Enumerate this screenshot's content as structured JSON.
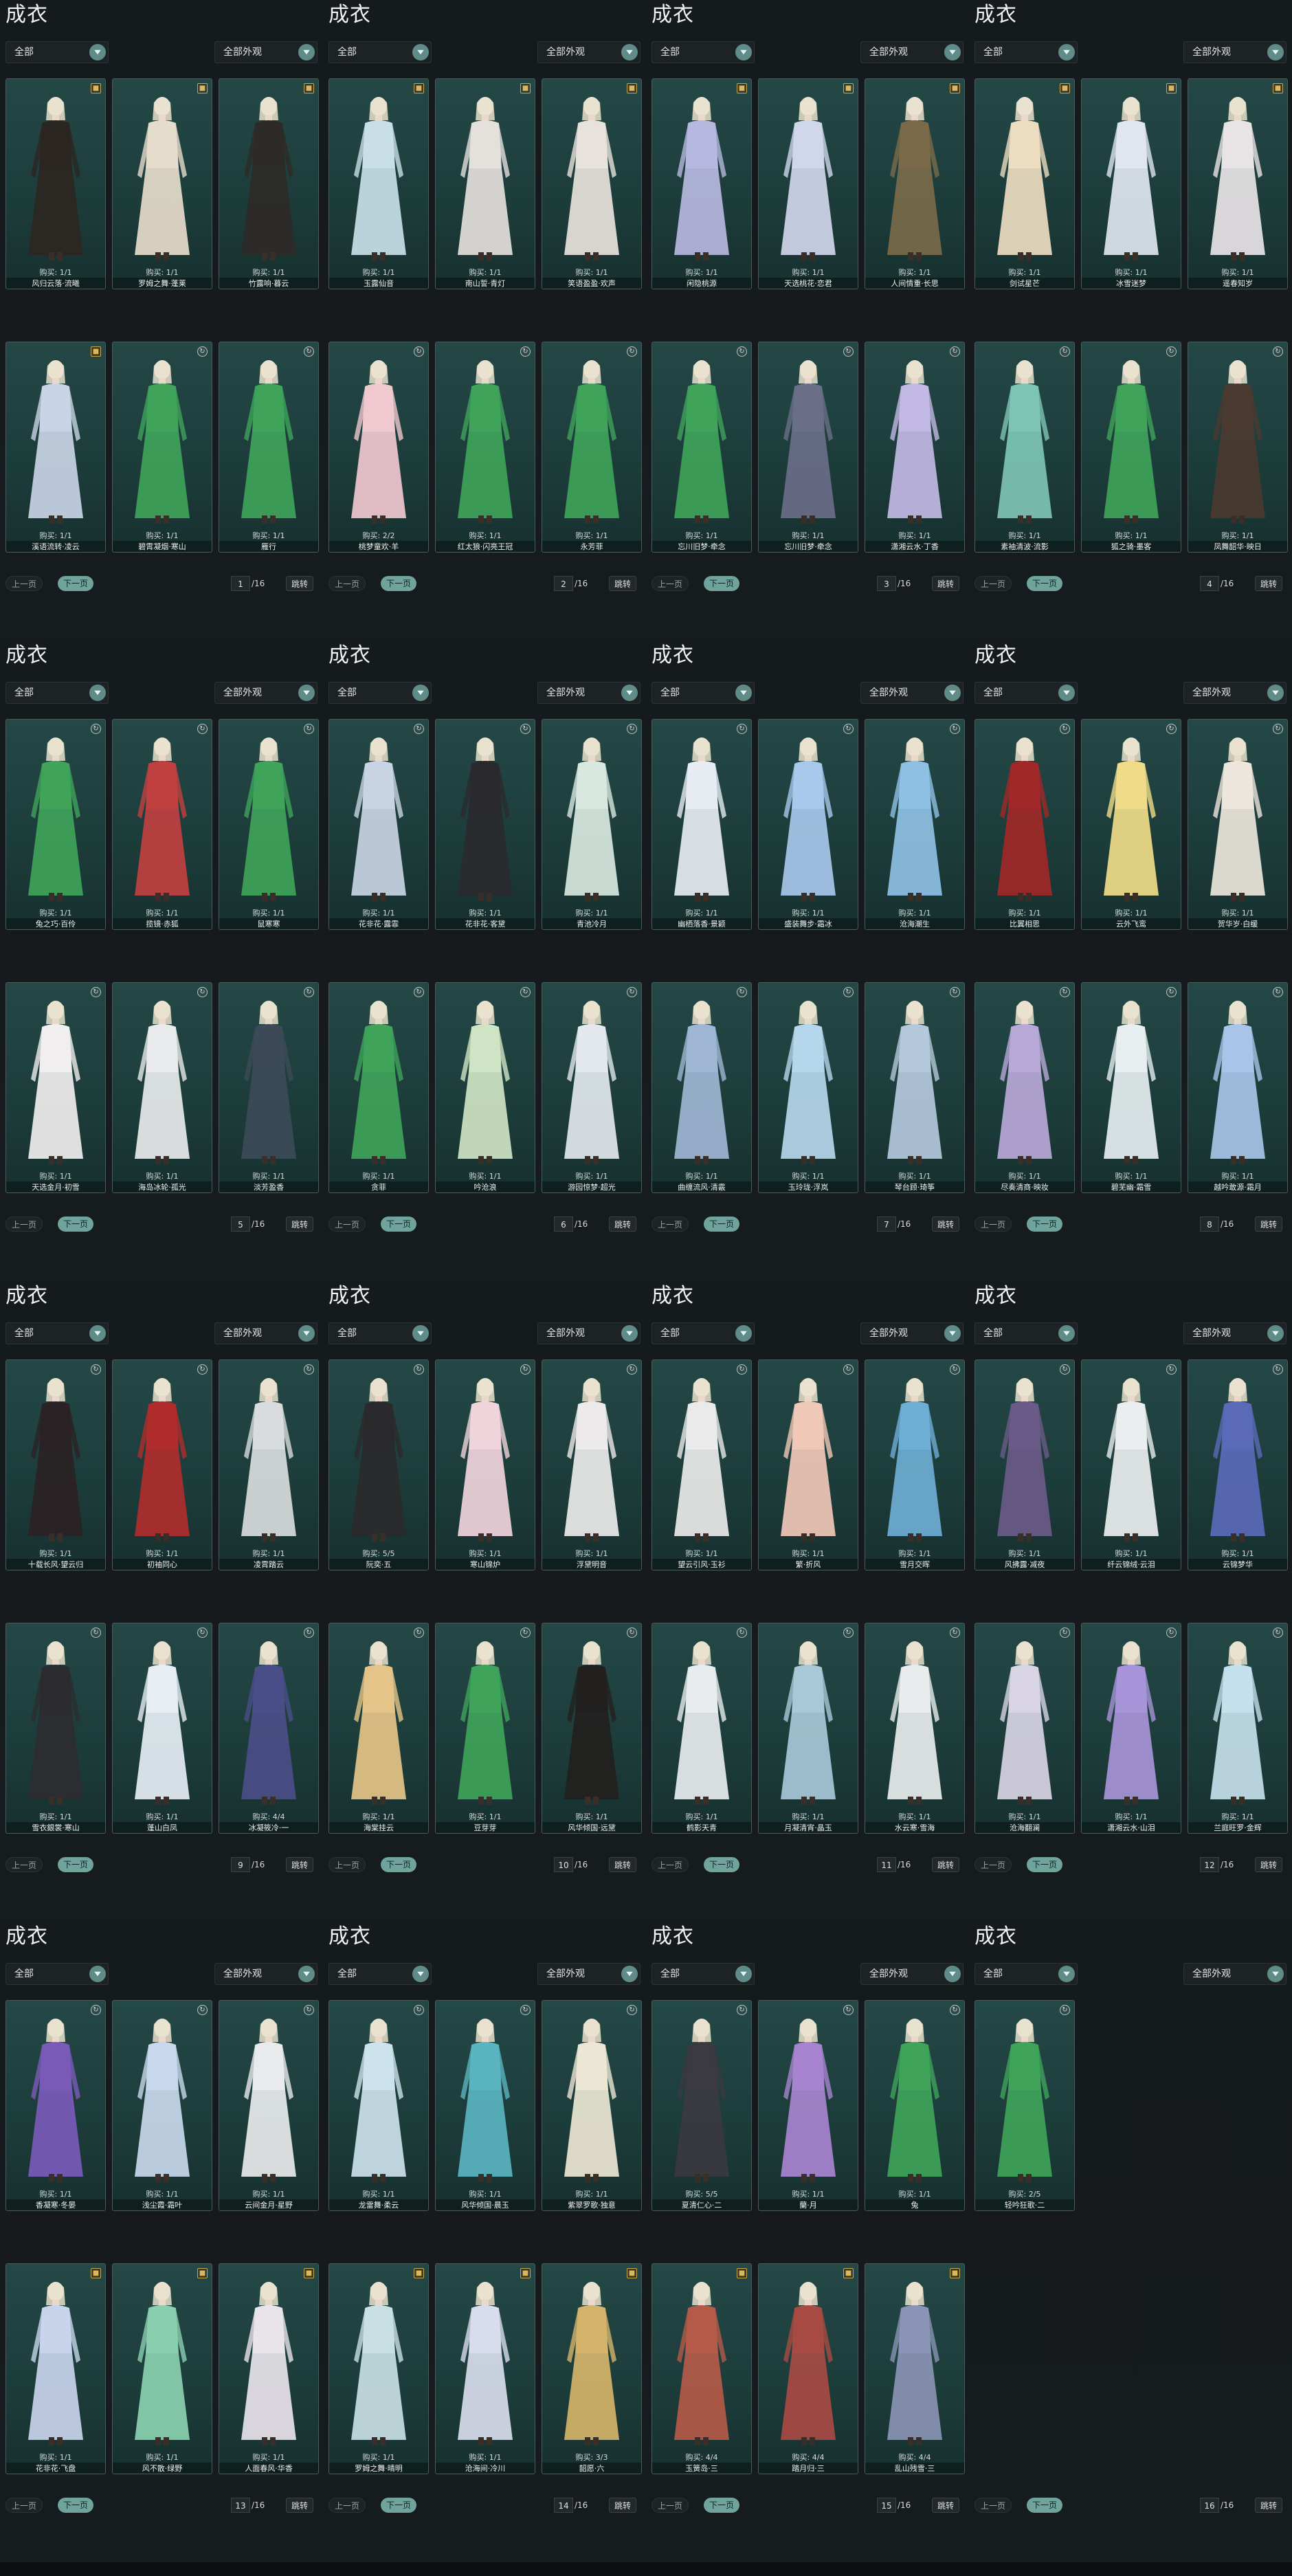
{
  "panel_title": "成衣",
  "filter_all": "全部",
  "filter_look": "全部外观",
  "buttons": {
    "prev": "上一页",
    "next": "下一页",
    "go": "跳转"
  },
  "total_pages": "/16",
  "colors": {
    "accent": "#6fa39c",
    "card_bg": "#244846",
    "gold_tag": "#c9a64b"
  },
  "panels": [
    {
      "page": "1",
      "items": [
        {
          "name": "风归云落·流曦",
          "buy": "购买: 1/1",
          "tag": "gold",
          "c": "#2c2622"
        },
        {
          "name": "罗姆之舞·蓬莱",
          "buy": "购买: 1/1",
          "tag": "gold",
          "c": "#e6dccb"
        },
        {
          "name": "竹露响·暮云",
          "buy": "购买: 1/1",
          "tag": "gold",
          "c": "#2e2a28"
        },
        {
          "name": "溪语流转·凌云",
          "buy": "购买: 1/1",
          "tag": "gold",
          "c": "#c8d4e6"
        },
        {
          "name": "碧霄凝烟·寒山",
          "buy": "购买: 1/1",
          "tag": "round",
          "c": "#3fa35a"
        },
        {
          "name": "雁行",
          "buy": "购买: 1/1",
          "tag": "round",
          "c": "#3fa35a"
        }
      ]
    },
    {
      "page": "2",
      "items": [
        {
          "name": "玉露仙音",
          "buy": "购买: 1/1",
          "tag": "gold",
          "c": "#c8dfe8"
        },
        {
          "name": "南山誓·青灯",
          "buy": "购买: 1/1",
          "tag": "gold",
          "c": "#e4e0dc"
        },
        {
          "name": "笑语盈盈·欢声",
          "buy": "购买: 1/1",
          "tag": "gold",
          "c": "#e8e2dc"
        },
        {
          "name": "桃梦童欢·羊",
          "buy": "购买: 2/2",
          "tag": "round",
          "c": "#f0c8d0"
        },
        {
          "name": "红太狼·闪亮王冠",
          "buy": "购买: 1/1",
          "tag": "round",
          "c": "#3fa35a"
        },
        {
          "name": "永芳菲",
          "buy": "购买: 1/1",
          "tag": "round",
          "c": "#3fa35a"
        }
      ]
    },
    {
      "page": "3",
      "items": [
        {
          "name": "闲隐桃源",
          "buy": "购买: 1/1",
          "tag": "gold",
          "c": "#b7b8e0"
        },
        {
          "name": "天选桃花·恋君",
          "buy": "购买: 1/1",
          "tag": "gold",
          "c": "#d0d6ec"
        },
        {
          "name": "人间情重·长思",
          "buy": "购买: 1/1",
          "tag": "gold",
          "c": "#7a6a4a"
        },
        {
          "name": "忘川旧梦·牵念",
          "buy": "购买: 1/1",
          "tag": "round",
          "c": "#3fa35a"
        },
        {
          "name": "忘川旧梦·牵念",
          "buy": "购买: 1/1",
          "tag": "round",
          "c": "#6a6e88"
        },
        {
          "name": "潇湘云水·丁香",
          "buy": "购买: 1/1",
          "tag": "round",
          "c": "#c2b8e4"
        }
      ]
    },
    {
      "page": "4",
      "items": [
        {
          "name": "剑试星芒",
          "buy": "购买: 1/1",
          "tag": "gold",
          "c": "#ecdcc0"
        },
        {
          "name": "冰雪迷梦",
          "buy": "购买: 1/1",
          "tag": "gold",
          "c": "#dfe6ee"
        },
        {
          "name": "遥春知岁",
          "buy": "购买: 1/1",
          "tag": "gold",
          "c": "#e8e4e6"
        },
        {
          "name": "素袖清波·流影",
          "buy": "购买: 1/1",
          "tag": "round",
          "c": "#7ec4b4"
        },
        {
          "name": "狐之骑·墨客",
          "buy": "购买: 1/1",
          "tag": "round",
          "c": "#3fa35a"
        },
        {
          "name": "凤舞韶华·映日",
          "buy": "购买: 1/1",
          "tag": "round",
          "c": "#4a3a30"
        }
      ]
    },
    {
      "page": "5",
      "items": [
        {
          "name": "兔之巧·百伶",
          "buy": "购买: 1/1",
          "tag": "round",
          "c": "#3fa35a"
        },
        {
          "name": "揽镜·赤狐",
          "buy": "购买: 1/1",
          "tag": "round",
          "c": "#c04040"
        },
        {
          "name": "鼠寒寒",
          "buy": "购买: 1/1",
          "tag": "round",
          "c": "#3fa35a"
        },
        {
          "name": "天选金月·初雪",
          "buy": "购买: 1/1",
          "tag": "round",
          "c": "#f0eeee"
        },
        {
          "name": "海岛冰轮·孤光",
          "buy": "购买: 1/1",
          "tag": "round",
          "c": "#e8eaec"
        },
        {
          "name": "淡芳盈香",
          "buy": "购买: 1/1",
          "tag": "round",
          "c": "#3c4a58"
        }
      ]
    },
    {
      "page": "6",
      "items": [
        {
          "name": "花非花·露霏",
          "buy": "购买: 1/1",
          "tag": "round",
          "c": "#c8d4e4"
        },
        {
          "name": "花非花·客黛",
          "buy": "购买: 1/1",
          "tag": "round",
          "c": "#2a2a2e"
        },
        {
          "name": "青池冷月",
          "buy": "购买: 1/1",
          "tag": "round",
          "c": "#d8e8e0"
        },
        {
          "name": "贪菲",
          "buy": "购买: 1/1",
          "tag": "round",
          "c": "#3fa35a"
        },
        {
          "name": "吟沧浪",
          "buy": "购买: 1/1",
          "tag": "round",
          "c": "#cfe4c4"
        },
        {
          "name": "游园惊梦·超光",
          "buy": "购买: 1/1",
          "tag": "round",
          "c": "#e2e8ec"
        }
      ]
    },
    {
      "page": "7",
      "items": [
        {
          "name": "幽栖落香·景颖",
          "buy": "购买: 1/1",
          "tag": "round",
          "c": "#e6ecf2"
        },
        {
          "name": "盛装舞步·霜冰",
          "buy": "购买: 1/1",
          "tag": "round",
          "c": "#a8c8ec"
        },
        {
          "name": "沧海潮生",
          "buy": "购买: 1/1",
          "tag": "round",
          "c": "#8ec0e4"
        },
        {
          "name": "曲缠流风·清霰",
          "buy": "购买: 1/1",
          "tag": "round",
          "c": "#9eb6d4"
        },
        {
          "name": "玉玲珑·浮岚",
          "buy": "购买: 1/1",
          "tag": "round",
          "c": "#b6d6ec"
        },
        {
          "name": "琴台顾·琦筝",
          "buy": "购买: 1/1",
          "tag": "round",
          "c": "#b4c8dc"
        }
      ]
    },
    {
      "page": "8",
      "items": [
        {
          "name": "比翼相思",
          "buy": "购买: 1/1",
          "tag": "round",
          "c": "#a02828"
        },
        {
          "name": "云外飞鸾",
          "buy": "购买: 1/1",
          "tag": "round",
          "c": "#f0dc88"
        },
        {
          "name": "贺华岁·白缓",
          "buy": "购买: 1/1",
          "tag": "round",
          "c": "#ece6dc"
        },
        {
          "name": "尽奏清商·映妆",
          "buy": "购买: 1/1",
          "tag": "round",
          "c": "#b8a8d8"
        },
        {
          "name": "碧芜幽·霜雪",
          "buy": "购买: 1/1",
          "tag": "round",
          "c": "#e6eef0"
        },
        {
          "name": "越吟敢源·霜月",
          "buy": "购买: 1/1",
          "tag": "round",
          "c": "#a8c4e8"
        }
      ]
    },
    {
      "page": "9",
      "items": [
        {
          "name": "十载长风·望云归",
          "buy": "购买: 1/1",
          "tag": "round",
          "c": "#2a2224"
        },
        {
          "name": "初袖同心",
          "buy": "购买: 1/1",
          "tag": "round",
          "c": "#b02c2c"
        },
        {
          "name": "凌霄踏云",
          "buy": "购买: 1/1",
          "tag": "round",
          "c": "#d8dcdc"
        },
        {
          "name": "雪衣銀裳·寒山",
          "buy": "购买: 1/1",
          "tag": "round",
          "c": "#2c2c30"
        },
        {
          "name": "蓬山白凤",
          "buy": "购买: 1/1",
          "tag": "round",
          "c": "#e6eef4"
        },
        {
          "name": "冰凝筱冷·一",
          "buy": "购买: 4/4",
          "tag": "round",
          "c": "#4a4e88"
        }
      ]
    },
    {
      "page": "10",
      "items": [
        {
          "name": "阮奕·五",
          "buy": "购买: 5/5",
          "tag": "round",
          "c": "#2a2a2c"
        },
        {
          "name": "寒山锦炉",
          "buy": "购买: 1/1",
          "tag": "round",
          "c": "#f0d4dc"
        },
        {
          "name": "浮黛明音",
          "buy": "购买: 1/1",
          "tag": "round",
          "c": "#eceaea"
        },
        {
          "name": "海棠挂云",
          "buy": "购买: 1/1",
          "tag": "round",
          "c": "#e4c488"
        },
        {
          "name": "豆芽芽",
          "buy": "购买: 1/1",
          "tag": "round",
          "c": "#3fa35a"
        },
        {
          "name": "风华倾国·远黛",
          "buy": "购买: 1/1",
          "tag": "round",
          "c": "#22201e"
        }
      ]
    },
    {
      "page": "11",
      "items": [
        {
          "name": "望云引风·玉衫",
          "buy": "购买: 1/1",
          "tag": "round",
          "c": "#eaeaea"
        },
        {
          "name": "繁·折风",
          "buy": "购买: 1/1",
          "tag": "round",
          "c": "#f0c8b8"
        },
        {
          "name": "雪月交晖",
          "buy": "购买: 1/1",
          "tag": "round",
          "c": "#6eaed4"
        },
        {
          "name": "鹤影天青",
          "buy": "购买: 1/1",
          "tag": "round",
          "c": "#e8ecee"
        },
        {
          "name": "月凝清宵·晶玉",
          "buy": "购买: 1/1",
          "tag": "round",
          "c": "#a8c8d8"
        },
        {
          "name": "水云寒·雪海",
          "buy": "购买: 1/1",
          "tag": "round",
          "c": "#e8ecec"
        }
      ]
    },
    {
      "page": "12",
      "items": [
        {
          "name": "风拂露·减夜",
          "buy": "购买: 1/1",
          "tag": "round",
          "c": "#6a5a88"
        },
        {
          "name": "纤云锦绒·云泪",
          "buy": "购买: 1/1",
          "tag": "round",
          "c": "#eaeeee"
        },
        {
          "name": "云锦梦华",
          "buy": "购买: 1/1",
          "tag": "round",
          "c": "#5a6ab8"
        },
        {
          "name": "沧海翻澜",
          "buy": "购买: 1/1",
          "tag": "round",
          "c": "#d8d4e4"
        },
        {
          "name": "潇湘云水·山泪",
          "buy": "购买: 1/1",
          "tag": "round",
          "c": "#a894d8"
        },
        {
          "name": "兰庭旺罗·金辉",
          "buy": "购买: 1/1",
          "tag": "round",
          "c": "#c4e0ec"
        }
      ]
    },
    {
      "page": "13",
      "items": [
        {
          "name": "香凝寒·冬晏",
          "buy": "购买: 1/1",
          "tag": "round",
          "c": "#7a5ab8"
        },
        {
          "name": "浅尘霞·霜叶",
          "buy": "购买: 1/1",
          "tag": "round",
          "c": "#c8d8ec"
        },
        {
          "name": "云间金月·星野",
          "buy": "购买: 1/1",
          "tag": "round",
          "c": "#e8eaec"
        },
        {
          "name": "花非花·飞盘",
          "buy": "购买: 1/1",
          "tag": "gold",
          "c": "#c8d4ec"
        },
        {
          "name": "风不散·绿野",
          "buy": "购买: 1/1",
          "tag": "gold",
          "c": "#8ad0b0"
        },
        {
          "name": "人面春风·华香",
          "buy": "购买: 1/1",
          "tag": "gold",
          "c": "#e8e4ea"
        }
      ]
    },
    {
      "page": "14",
      "items": [
        {
          "name": "龙雷舞·柔云",
          "buy": "购买: 1/1",
          "tag": "round",
          "c": "#cce2ec"
        },
        {
          "name": "风华倾国·晨玉",
          "buy": "购买: 1/1",
          "tag": "round",
          "c": "#5ab4c0"
        },
        {
          "name": "紫翠罗歌·独意",
          "buy": "购买: 1/1",
          "tag": "round",
          "c": "#ece6d4"
        },
        {
          "name": "罗姆之舞·晴明",
          "buy": "购买: 1/1",
          "tag": "gold",
          "c": "#c8e0e4"
        },
        {
          "name": "沧海间·冷川",
          "buy": "购买: 1/1",
          "tag": "gold",
          "c": "#d8dcec"
        },
        {
          "name": "韶愿·六",
          "buy": "购买: 3/3",
          "tag": "gold",
          "c": "#d4b46a"
        }
      ]
    },
    {
      "page": "15",
      "items": [
        {
          "name": "夏清仁心·二",
          "buy": "购买: 5/5",
          "tag": "round",
          "c": "#3a3a40"
        },
        {
          "name": "蘭·月",
          "buy": "购买: 1/1",
          "tag": "round",
          "c": "#a884d0"
        },
        {
          "name": "兔",
          "buy": "购买: 1/1",
          "tag": "round",
          "c": "#3fa35a"
        },
        {
          "name": "玉簧岛·三",
          "buy": "购买: 4/4",
          "tag": "gold",
          "c": "#b45a48"
        },
        {
          "name": "踏月归·三",
          "buy": "购买: 4/4",
          "tag": "gold",
          "c": "#a84a44"
        },
        {
          "name": "乱山残雪·三",
          "buy": "购买: 4/4",
          "tag": "gold",
          "c": "#8a94b4"
        }
      ]
    },
    {
      "page": "16",
      "items": [
        {
          "name": "轻吟狂歌·二",
          "buy": "购买: 2/5",
          "tag": "round",
          "c": "#3fa35a"
        }
      ]
    }
  ]
}
